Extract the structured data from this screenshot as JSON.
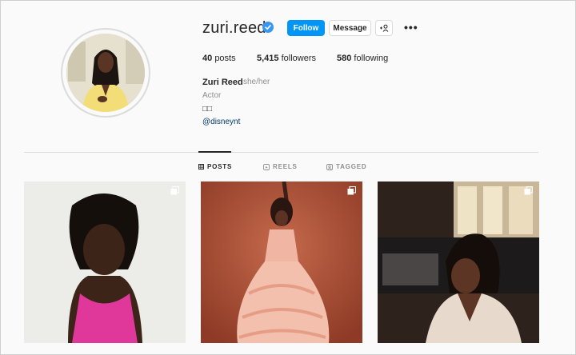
{
  "profile": {
    "username": "zuri.reed",
    "verified": true,
    "buttons": {
      "follow": "Follow",
      "message": "Message",
      "suggest": "+ &"
    },
    "stats": {
      "posts_count": "40",
      "posts_label": "posts",
      "followers_count": "5,415",
      "followers_label": "followers",
      "following_count": "580",
      "following_label": "following"
    },
    "bio": {
      "name": "Zuri Reed",
      "pronouns": "she/her",
      "category": "Actor",
      "glyphs": "□□",
      "link": "@disneynt"
    }
  },
  "tabs": [
    {
      "label": "POSTS",
      "icon": "grid-icon",
      "active": true
    },
    {
      "label": "REELS",
      "icon": "reels-icon",
      "active": false
    },
    {
      "label": "TAGGED",
      "icon": "tagged-icon",
      "active": false
    }
  ],
  "posts": [
    {
      "icon": "multiple-photos-icon",
      "bg": "#eeeeec",
      "accent": "#e0389a"
    },
    {
      "icon": "multiple-photos-icon",
      "bg": "#b4553a",
      "accent": "#f1b6a3"
    },
    {
      "icon": "multiple-photos-icon",
      "bg": "#3a2b22",
      "accent": "#e8d9cd"
    }
  ],
  "colors": {
    "accent": "#0095f6",
    "verified": "#3897f0",
    "link": "#00376b"
  }
}
